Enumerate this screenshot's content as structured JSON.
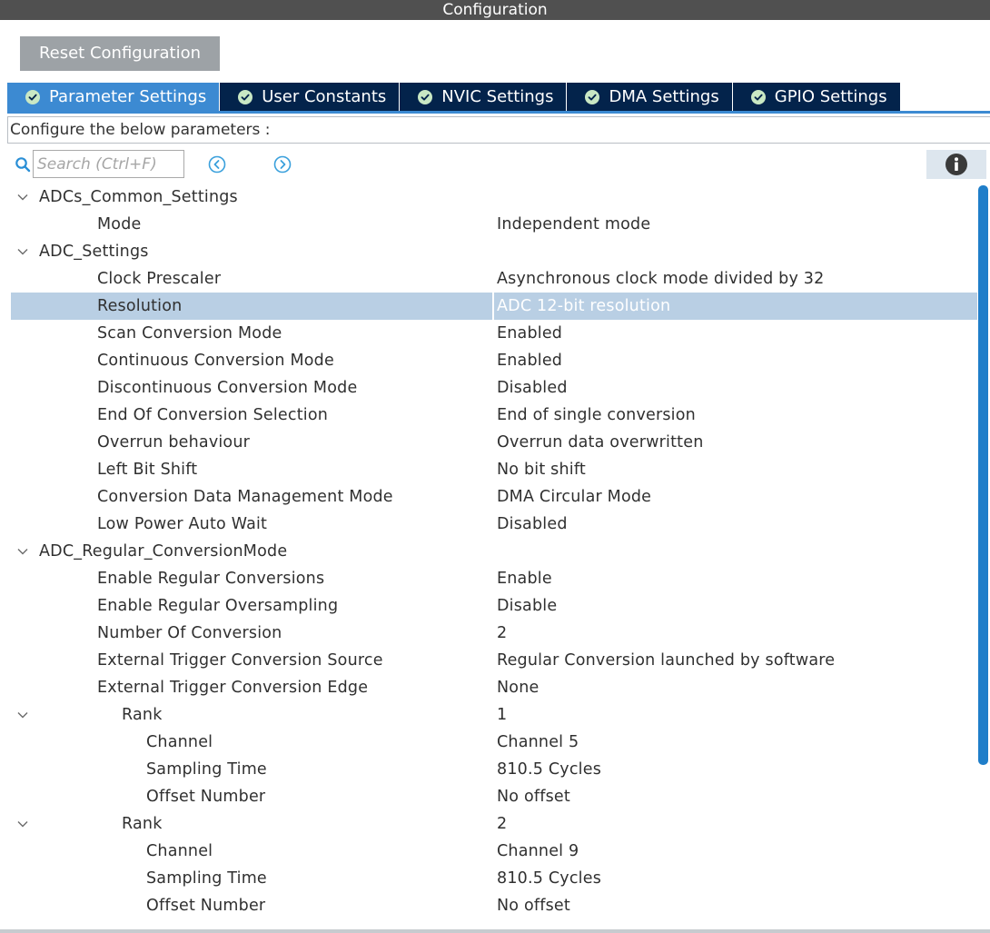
{
  "window": {
    "title": "Configuration"
  },
  "toolbar": {
    "reset_label": "Reset Configuration"
  },
  "tabs": [
    {
      "label": "Parameter Settings",
      "active": true
    },
    {
      "label": "User Constants",
      "active": false
    },
    {
      "label": "NVIC Settings",
      "active": false
    },
    {
      "label": "DMA Settings",
      "active": false
    },
    {
      "label": "GPIO Settings",
      "active": false
    }
  ],
  "description": "Configure the below parameters :",
  "search": {
    "placeholder": "Search (Ctrl+F)",
    "value": ""
  },
  "icons": {
    "search": "search-icon",
    "prev": "arrow-left-circle-icon",
    "next": "arrow-right-circle-icon",
    "info": "info-icon",
    "expand": "chevron-down-icon",
    "tab_status": "check-circle-icon"
  },
  "colors": {
    "titlebar": "#505050",
    "tab_inactive": "#03234b",
    "tab_active": "#3c8ad2",
    "selected_row": "#b9cfe4",
    "scrollbar": "#1f7ec9"
  },
  "tree": [
    {
      "type": "group",
      "level": 0,
      "label": "ADCs_Common_Settings"
    },
    {
      "type": "param",
      "level": 1,
      "label": "Mode",
      "value": "Independent mode"
    },
    {
      "type": "group",
      "level": 0,
      "label": "ADC_Settings"
    },
    {
      "type": "param",
      "level": 1,
      "label": "Clock Prescaler",
      "value": "Asynchronous clock mode divided by 32"
    },
    {
      "type": "param",
      "level": 1,
      "label": "Resolution",
      "value": "ADC 12-bit resolution",
      "selected": true
    },
    {
      "type": "param",
      "level": 1,
      "label": "Scan Conversion Mode",
      "value": "Enabled"
    },
    {
      "type": "param",
      "level": 1,
      "label": "Continuous Conversion Mode",
      "value": "Enabled"
    },
    {
      "type": "param",
      "level": 1,
      "label": "Discontinuous Conversion Mode",
      "value": "Disabled"
    },
    {
      "type": "param",
      "level": 1,
      "label": "End Of Conversion Selection",
      "value": "End of single conversion"
    },
    {
      "type": "param",
      "level": 1,
      "label": "Overrun behaviour",
      "value": "Overrun data overwritten"
    },
    {
      "type": "param",
      "level": 1,
      "label": "Left Bit Shift",
      "value": "No bit shift"
    },
    {
      "type": "param",
      "level": 1,
      "label": "Conversion Data Management Mode",
      "value": "DMA Circular Mode"
    },
    {
      "type": "param",
      "level": 1,
      "label": "Low Power Auto Wait",
      "value": "Disabled"
    },
    {
      "type": "group",
      "level": 0,
      "label": "ADC_Regular_ConversionMode"
    },
    {
      "type": "param",
      "level": 1,
      "label": "Enable Regular Conversions",
      "value": "Enable"
    },
    {
      "type": "param",
      "level": 1,
      "label": "Enable Regular Oversampling",
      "value": "Disable"
    },
    {
      "type": "param",
      "level": 1,
      "label": "Number Of Conversion",
      "value": "2"
    },
    {
      "type": "param",
      "level": 1,
      "label": "External Trigger Conversion Source",
      "value": "Regular Conversion launched by software"
    },
    {
      "type": "param",
      "level": 1,
      "label": "External Trigger Conversion Edge",
      "value": "None"
    },
    {
      "type": "group",
      "level": 2,
      "label": "Rank",
      "value": "1"
    },
    {
      "type": "param",
      "level": 3,
      "label": "Channel",
      "value": "Channel 5"
    },
    {
      "type": "param",
      "level": 3,
      "label": "Sampling Time",
      "value": "810.5 Cycles"
    },
    {
      "type": "param",
      "level": 3,
      "label": "Offset Number",
      "value": "No offset"
    },
    {
      "type": "group",
      "level": 2,
      "label": "Rank",
      "value": "2"
    },
    {
      "type": "param",
      "level": 3,
      "label": "Channel",
      "value": "Channel 9"
    },
    {
      "type": "param",
      "level": 3,
      "label": "Sampling Time",
      "value": "810.5 Cycles"
    },
    {
      "type": "param",
      "level": 3,
      "label": "Offset Number",
      "value": "No offset"
    }
  ]
}
